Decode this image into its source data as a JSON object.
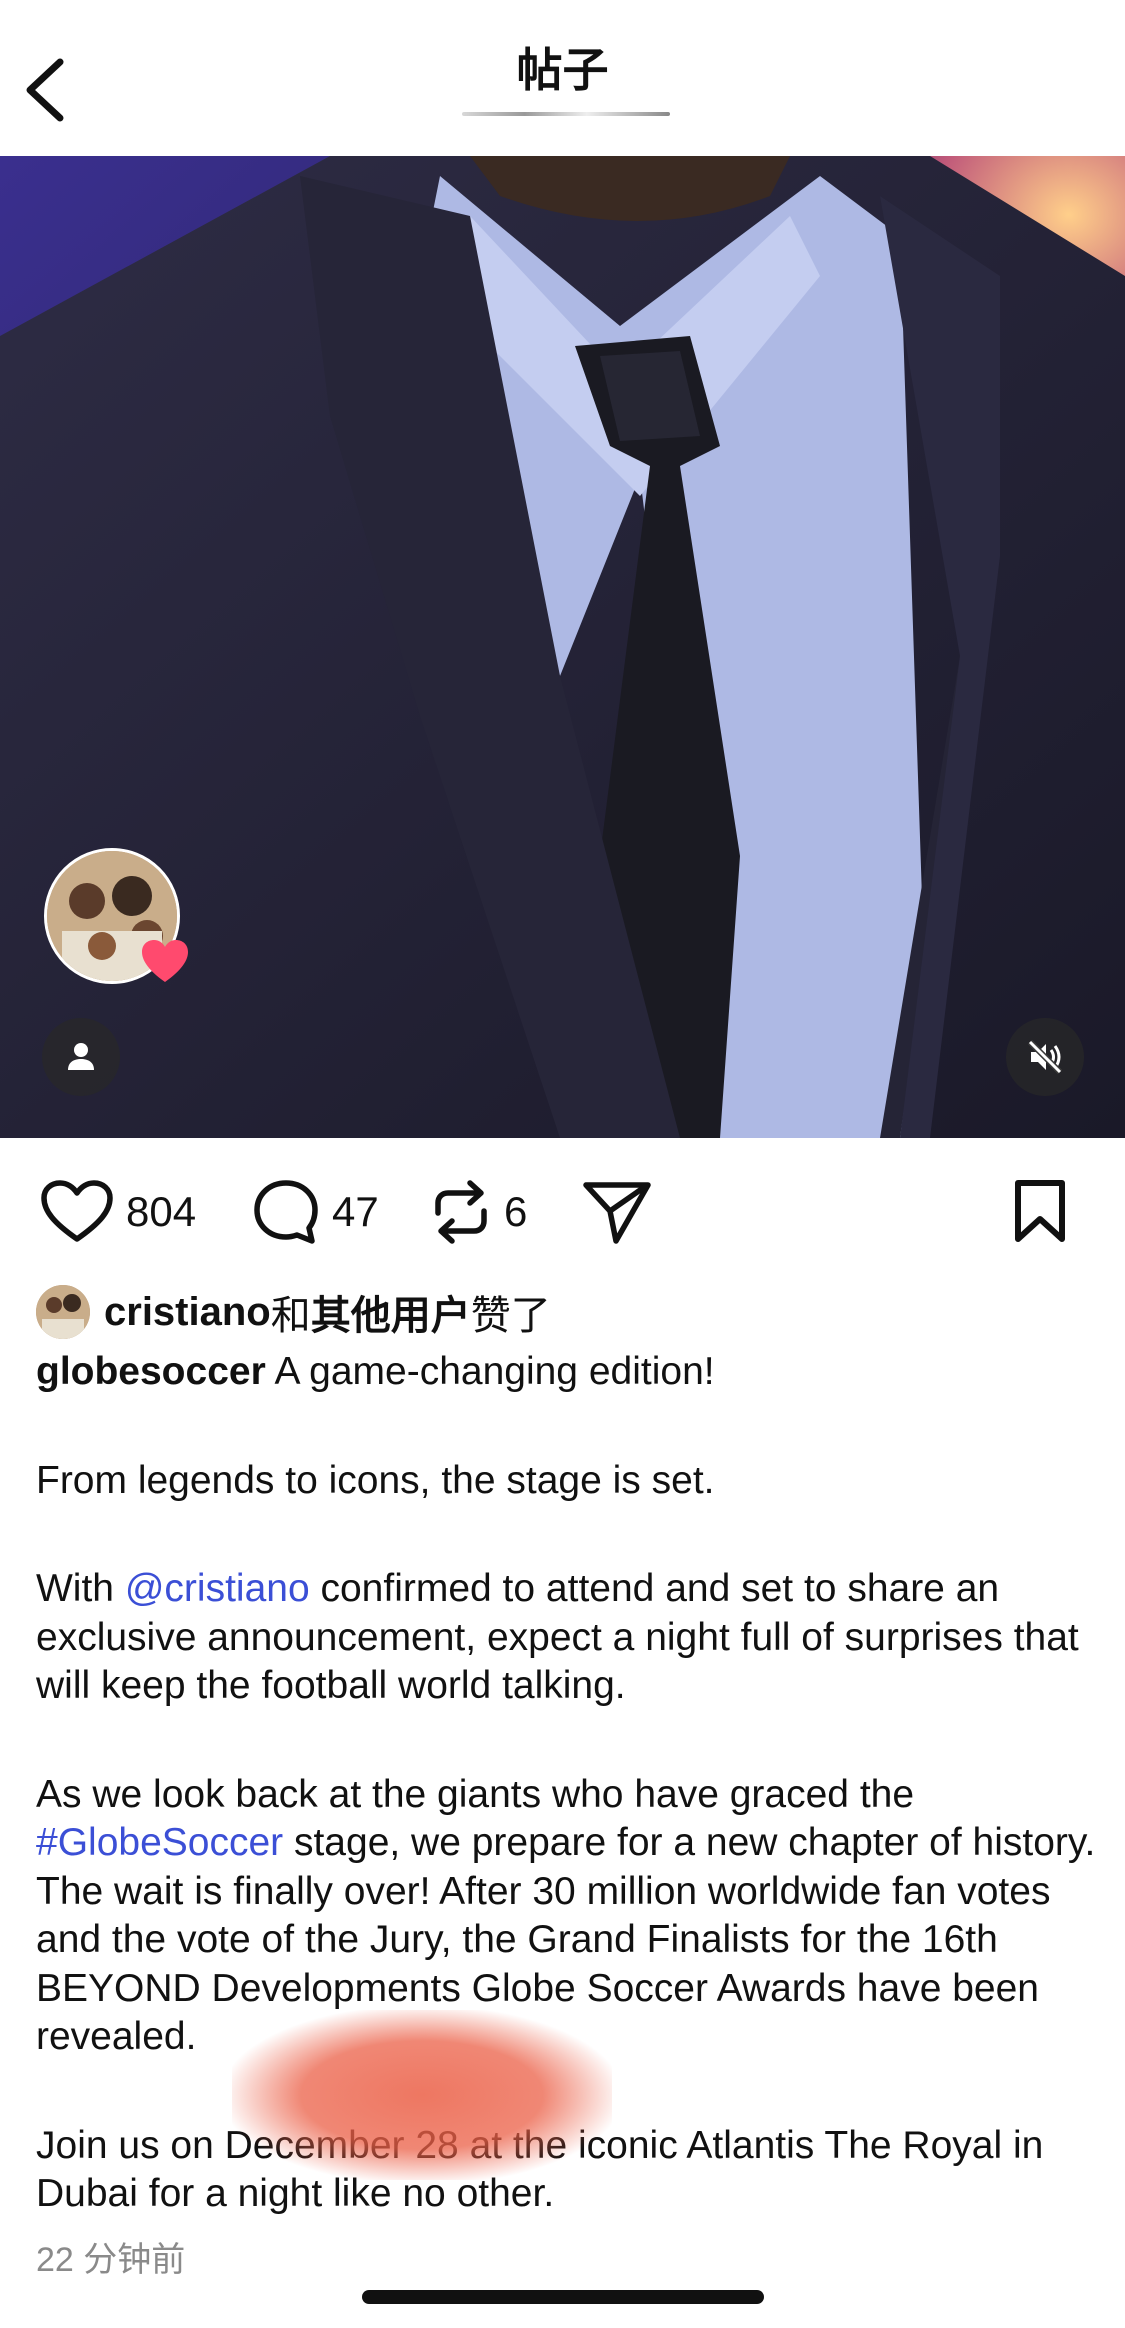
{
  "header": {
    "title": "帖子",
    "back_icon": "chevron-left-icon"
  },
  "media": {
    "type": "video",
    "description_icon": "person-icon",
    "mute_icon": "speaker-muted-icon",
    "story_avatar_badge": "heart-icon",
    "badge_color": "#ff4a6e"
  },
  "actions": {
    "like_count": "804",
    "comment_count": "47",
    "repost_count": "6"
  },
  "liked_by": {
    "user": "cristiano",
    "connector": "和",
    "others": "其他用户",
    "suffix": "赞了"
  },
  "caption": {
    "username": "globesoccer",
    "line1": " A game-changing edition!",
    "para2": "From legends to icons, the stage is set.",
    "para3_pre": "With ",
    "para3_mention": "@cristiano",
    "para3_post": " confirmed to attend and set to share an exclusive announcement, expect a night full of surprises that will keep the football world talking.",
    "para4_pre": "As we look back at the giants who have graced the ",
    "para4_hashtag": "#GlobeSoccer",
    "para4_post": " stage, we prepare for a new chapter of history. The wait is finally over! After 30 million worldwide fan votes and the vote of the Jury, the Grand Finalists for the 16th BEYOND Developments Globe Soccer Awards have been revealed.",
    "para5": "Join us on December 28 at the iconic Atlantis The Royal in Dubai for a night like no other."
  },
  "timestamp": "22 分钟前",
  "colors": {
    "link": "#3b4fd6",
    "text": "#111111",
    "muted": "#8a8a8a"
  }
}
